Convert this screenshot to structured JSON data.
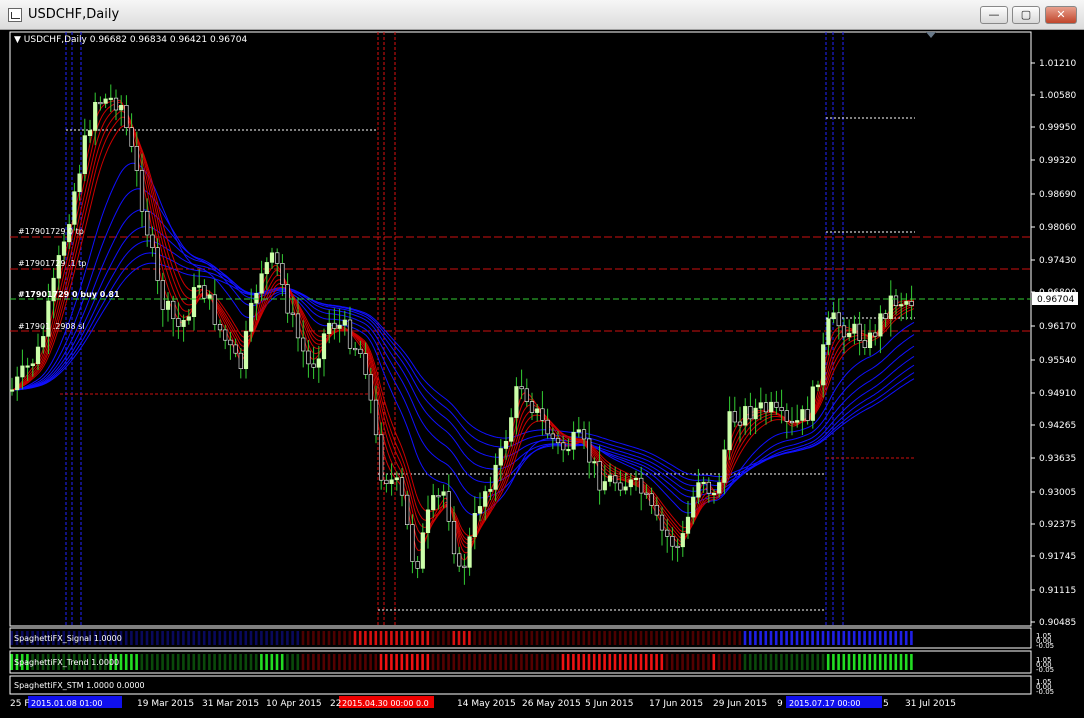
{
  "window": {
    "title": "USDCHF,Daily",
    "minimize_glyph": "—",
    "maximize_glyph": "▢",
    "close_glyph": "✕"
  },
  "chart": {
    "header": "▼ USDCHF,Daily  0.96682 0.96834 0.96421 0.96704",
    "current_price": "0.96704",
    "y_ticks": [
      "1.01210",
      "1.00580",
      "0.99950",
      "0.99320",
      "0.98690",
      "0.98060",
      "0.97430",
      "0.96800",
      "0.96170",
      "0.95540",
      "0.94910",
      "0.94265",
      "0.93635",
      "0.93005",
      "0.92375",
      "0.91745",
      "0.91115",
      "0.90485"
    ],
    "x_ticks": [
      "25 F",
      "19 Mar 2015",
      "31 Mar 2015",
      "10 Apr 2015",
      "22",
      "14 May 2015",
      "26 May 2015",
      "5 Jun 2015",
      "17 Jun 2015",
      "29 Jun 2015",
      "9",
      "5",
      "31 Jul 2015"
    ],
    "x_highlights": [
      "2015.01.08 01:00",
      "2015.04.30 00:00 0.0",
      "2015.07.17 00:00"
    ],
    "trade_labels": [
      "#17901729 0 tp",
      "#17901729 .1 tp",
      "#17901729 0 buy 0.81",
      "#17901 .2908 sl"
    ]
  },
  "indicators": {
    "signal_label": "SpaghettiFX_Signal 1.0000",
    "signal_scale": [
      "1.05",
      "0.00",
      "-0.05"
    ],
    "trend_label": "SpaghettiFX_Trend 1.0000",
    "trend_scale": [
      "1.05",
      "0.00",
      "-0.05"
    ],
    "stm_label": "SpaghettiFX_STM 1.0000 0.0000",
    "stm_scale": [
      "1.05",
      "0.00",
      "-0.05"
    ]
  },
  "colors": {
    "background": "#000000",
    "bull": "#ccffaa",
    "bear": "#000000",
    "wick": "#33cc33",
    "ribbon_red": "#cc0000",
    "ribbon_blue": "#1010ff",
    "current": "#33cc33",
    "axis_text": "#ffffff"
  }
}
